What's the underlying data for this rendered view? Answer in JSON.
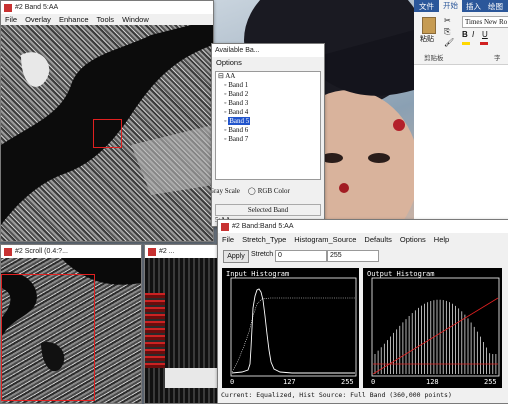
{
  "win_main": {
    "title": "#2 Band 5:AA",
    "menu": [
      "File",
      "Overlay",
      "Enhance",
      "Tools",
      "Window"
    ]
  },
  "band_list": {
    "title": "Available Ba...",
    "options_label": "Options",
    "root": "AA",
    "bands": [
      "Band 1",
      "Band 2",
      "Band 3",
      "Band 4",
      "Band 5",
      "Band 6",
      "Band 7"
    ],
    "selected_index": 4,
    "gray_scale": "Gray Scale",
    "rgb_color": "RGB Color",
    "selected_band": "Selected Band",
    "selected_value": "5:AA"
  },
  "win_scroll": {
    "title": "#2 Scroll (0.4:?..."
  },
  "win_zoom": {
    "title": "#2 ..."
  },
  "word": {
    "tabs": [
      "文件",
      "开始",
      "插入",
      "绘图"
    ],
    "font_name": "Times New Ro",
    "clipboard": "剪贴板",
    "paste": "粘贴",
    "font_group": "字"
  },
  "histogram": {
    "title": "#2 Band:Band 5:AA",
    "menu": [
      "File",
      "Stretch_Type",
      "Histogram_Source",
      "Defaults",
      "Options",
      "Help"
    ],
    "apply": "Apply",
    "stretch_label": "Stretch",
    "stretch_min": "0",
    "stretch_max": "255",
    "input_title": "Input Histogram",
    "output_title": "Output Histogram",
    "input_ticks": [
      "0",
      "127",
      "255"
    ],
    "output_ticks": [
      "0",
      "128",
      "255"
    ],
    "status": "Current: Equalized, Hist Source: Full Band (360,000 points)"
  },
  "colors": {
    "highlight": "#2255cc",
    "plot_bg": "#000000",
    "plot_line": "#ffffff",
    "marker": "#e02020"
  }
}
